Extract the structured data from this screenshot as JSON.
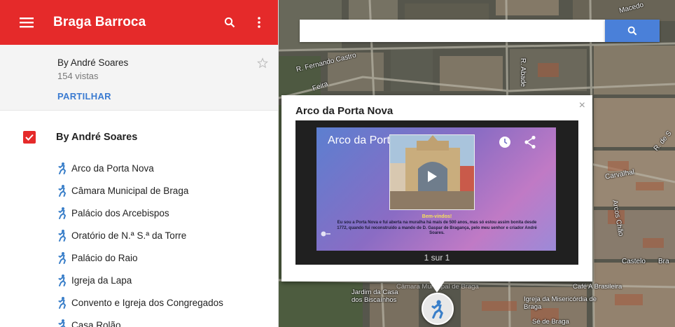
{
  "app": {
    "title": "Braga Barroca",
    "accent": "#e52a2a"
  },
  "info": {
    "author": "By André Soares",
    "views": "154 vistas",
    "share_label": "PARTILHAR"
  },
  "layer": {
    "title": "By André Soares",
    "checked": true
  },
  "places": [
    {
      "label": "Arco da Porta Nova",
      "icon": "walking-pin-icon"
    },
    {
      "label": "Câmara Municipal de Braga",
      "icon": "walking-pin-icon"
    },
    {
      "label": "Palácio dos Arcebispos",
      "icon": "walking-pin-icon"
    },
    {
      "label": "Oratório de N.ª S.ª da Torre",
      "icon": "walking-pin-icon"
    },
    {
      "label": "Palácio do Raio",
      "icon": "walking-pin-icon"
    },
    {
      "label": "Igreja da Lapa",
      "icon": "walking-pin-icon"
    },
    {
      "label": "Convento e Igreja dos Congregados",
      "icon": "walking-pin-icon"
    },
    {
      "label": "Casa Rolão",
      "icon": "walking-pin-icon"
    }
  ],
  "map": {
    "search_placeholder": "",
    "streets": [
      "R. Fernando Castro",
      "R. Abade",
      "Feira",
      "Carvalhal",
      "Castelo",
      "Bra",
      "R. de S",
      "Macedo",
      "Arcos Chão"
    ],
    "pois": [
      "Jardim da Casa dos Biscaínhos",
      "Café A Brasileira",
      "Igreja da Misericórdia de Braga",
      "Sé de Braga",
      "Câmara Municipal de Braga"
    ]
  },
  "popup": {
    "title": "Arco da Porta Nova",
    "close": "×",
    "slide_title": "Arco da Porta Nova",
    "welcome": "Bem-vindos!",
    "slide_text": "Eu sou a Porta Nova e fui aberta na muralha há mais de 500 anos, mas só estou assim bonita desde 1772, quando fui reconstruído a mando de D. Gaspar de Bragança, pelo meu senhor e criador André Soares.",
    "pager": "1 sur 1"
  }
}
